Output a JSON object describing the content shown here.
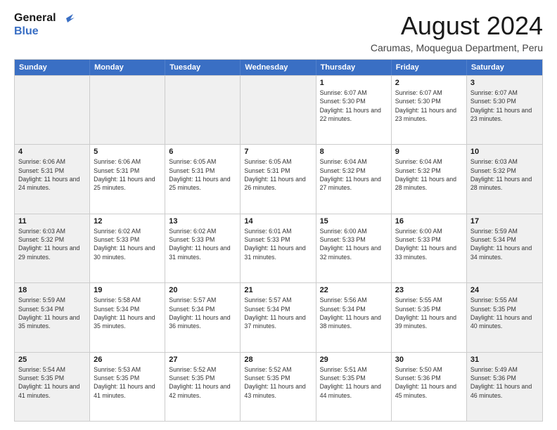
{
  "logo": {
    "line1": "General",
    "line2": "Blue"
  },
  "title": "August 2024",
  "subtitle": "Carumas, Moquegua Department, Peru",
  "days_of_week": [
    "Sunday",
    "Monday",
    "Tuesday",
    "Wednesday",
    "Thursday",
    "Friday",
    "Saturday"
  ],
  "weeks": [
    [
      {
        "day": "",
        "info": ""
      },
      {
        "day": "",
        "info": ""
      },
      {
        "day": "",
        "info": ""
      },
      {
        "day": "",
        "info": ""
      },
      {
        "day": "1",
        "info": "Sunrise: 6:07 AM\nSunset: 5:30 PM\nDaylight: 11 hours and 22 minutes."
      },
      {
        "day": "2",
        "info": "Sunrise: 6:07 AM\nSunset: 5:30 PM\nDaylight: 11 hours and 23 minutes."
      },
      {
        "day": "3",
        "info": "Sunrise: 6:07 AM\nSunset: 5:30 PM\nDaylight: 11 hours and 23 minutes."
      }
    ],
    [
      {
        "day": "4",
        "info": "Sunrise: 6:06 AM\nSunset: 5:31 PM\nDaylight: 11 hours and 24 minutes."
      },
      {
        "day": "5",
        "info": "Sunrise: 6:06 AM\nSunset: 5:31 PM\nDaylight: 11 hours and 25 minutes."
      },
      {
        "day": "6",
        "info": "Sunrise: 6:05 AM\nSunset: 5:31 PM\nDaylight: 11 hours and 25 minutes."
      },
      {
        "day": "7",
        "info": "Sunrise: 6:05 AM\nSunset: 5:31 PM\nDaylight: 11 hours and 26 minutes."
      },
      {
        "day": "8",
        "info": "Sunrise: 6:04 AM\nSunset: 5:32 PM\nDaylight: 11 hours and 27 minutes."
      },
      {
        "day": "9",
        "info": "Sunrise: 6:04 AM\nSunset: 5:32 PM\nDaylight: 11 hours and 28 minutes."
      },
      {
        "day": "10",
        "info": "Sunrise: 6:03 AM\nSunset: 5:32 PM\nDaylight: 11 hours and 28 minutes."
      }
    ],
    [
      {
        "day": "11",
        "info": "Sunrise: 6:03 AM\nSunset: 5:32 PM\nDaylight: 11 hours and 29 minutes."
      },
      {
        "day": "12",
        "info": "Sunrise: 6:02 AM\nSunset: 5:33 PM\nDaylight: 11 hours and 30 minutes."
      },
      {
        "day": "13",
        "info": "Sunrise: 6:02 AM\nSunset: 5:33 PM\nDaylight: 11 hours and 31 minutes."
      },
      {
        "day": "14",
        "info": "Sunrise: 6:01 AM\nSunset: 5:33 PM\nDaylight: 11 hours and 31 minutes."
      },
      {
        "day": "15",
        "info": "Sunrise: 6:00 AM\nSunset: 5:33 PM\nDaylight: 11 hours and 32 minutes."
      },
      {
        "day": "16",
        "info": "Sunrise: 6:00 AM\nSunset: 5:33 PM\nDaylight: 11 hours and 33 minutes."
      },
      {
        "day": "17",
        "info": "Sunrise: 5:59 AM\nSunset: 5:34 PM\nDaylight: 11 hours and 34 minutes."
      }
    ],
    [
      {
        "day": "18",
        "info": "Sunrise: 5:59 AM\nSunset: 5:34 PM\nDaylight: 11 hours and 35 minutes."
      },
      {
        "day": "19",
        "info": "Sunrise: 5:58 AM\nSunset: 5:34 PM\nDaylight: 11 hours and 35 minutes."
      },
      {
        "day": "20",
        "info": "Sunrise: 5:57 AM\nSunset: 5:34 PM\nDaylight: 11 hours and 36 minutes."
      },
      {
        "day": "21",
        "info": "Sunrise: 5:57 AM\nSunset: 5:34 PM\nDaylight: 11 hours and 37 minutes."
      },
      {
        "day": "22",
        "info": "Sunrise: 5:56 AM\nSunset: 5:34 PM\nDaylight: 11 hours and 38 minutes."
      },
      {
        "day": "23",
        "info": "Sunrise: 5:55 AM\nSunset: 5:35 PM\nDaylight: 11 hours and 39 minutes."
      },
      {
        "day": "24",
        "info": "Sunrise: 5:55 AM\nSunset: 5:35 PM\nDaylight: 11 hours and 40 minutes."
      }
    ],
    [
      {
        "day": "25",
        "info": "Sunrise: 5:54 AM\nSunset: 5:35 PM\nDaylight: 11 hours and 41 minutes."
      },
      {
        "day": "26",
        "info": "Sunrise: 5:53 AM\nSunset: 5:35 PM\nDaylight: 11 hours and 41 minutes."
      },
      {
        "day": "27",
        "info": "Sunrise: 5:52 AM\nSunset: 5:35 PM\nDaylight: 11 hours and 42 minutes."
      },
      {
        "day": "28",
        "info": "Sunrise: 5:52 AM\nSunset: 5:35 PM\nDaylight: 11 hours and 43 minutes."
      },
      {
        "day": "29",
        "info": "Sunrise: 5:51 AM\nSunset: 5:35 PM\nDaylight: 11 hours and 44 minutes."
      },
      {
        "day": "30",
        "info": "Sunrise: 5:50 AM\nSunset: 5:36 PM\nDaylight: 11 hours and 45 minutes."
      },
      {
        "day": "31",
        "info": "Sunrise: 5:49 AM\nSunset: 5:36 PM\nDaylight: 11 hours and 46 minutes."
      }
    ]
  ]
}
